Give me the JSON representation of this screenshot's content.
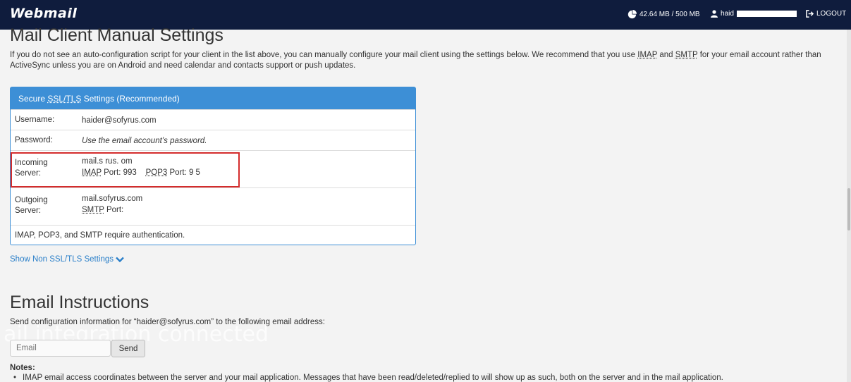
{
  "header": {
    "logo": "Webmail",
    "quota": "42.64 MB / 500 MB",
    "user": "haid",
    "logout": "LOGOUT"
  },
  "manual": {
    "title": "Mail Client Manual Settings",
    "intro_1": "If you do not see an auto-configuration script for your client in the list above, you can manually configure your mail client using the settings below. We recommend that you use ",
    "imap": "IMAP",
    "and": " and ",
    "smtp": "SMTP",
    "intro_2": " for your email account rather than ActiveSync unless you are on Android and need calendar and contacts support or push updates."
  },
  "panel": {
    "title_ssl": "SSL/TLS",
    "title_prefix": "Secure ",
    "title_suffix": " Settings (Recommended)",
    "username_label": "Username:",
    "username_value": "haider@sofyrus.com",
    "password_label": "Password:",
    "password_value": "Use the email account’s password.",
    "incoming_label": "Incoming Server:",
    "incoming_host": "mail.s  rus.  om",
    "incoming_imap": "IMAP",
    "incoming_imap_port": " Port: 993",
    "incoming_pop3": "POP3",
    "incoming_pop3_port": " Port: 9 5",
    "outgoing_label": "Outgoing Server:",
    "outgoing_host": "mail.sofyrus.com",
    "outgoing_smtp": "SMTP",
    "outgoing_port": " Port:",
    "auth_note": "IMAP, POP3, and SMTP require authentication."
  },
  "show_link": "Show Non SSL/TLS Settings",
  "instructions": {
    "title": "Email Instructions",
    "text": "Send configuration information for “haider@sofyrus.com” to the following email address:",
    "watermark": "ail integration connected",
    "email_placeholder": "Email",
    "send_label": "Send",
    "notes_title": "Notes:",
    "note_1": "IMAP email access coordinates between the server and your mail application. Messages that have been read/deleted/replied to will show up as such, both on the server and in the mail application."
  },
  "colors": {
    "header_bg": "#0f1c3d",
    "accent": "#3d8fd6",
    "highlight": "#d42c2c"
  }
}
